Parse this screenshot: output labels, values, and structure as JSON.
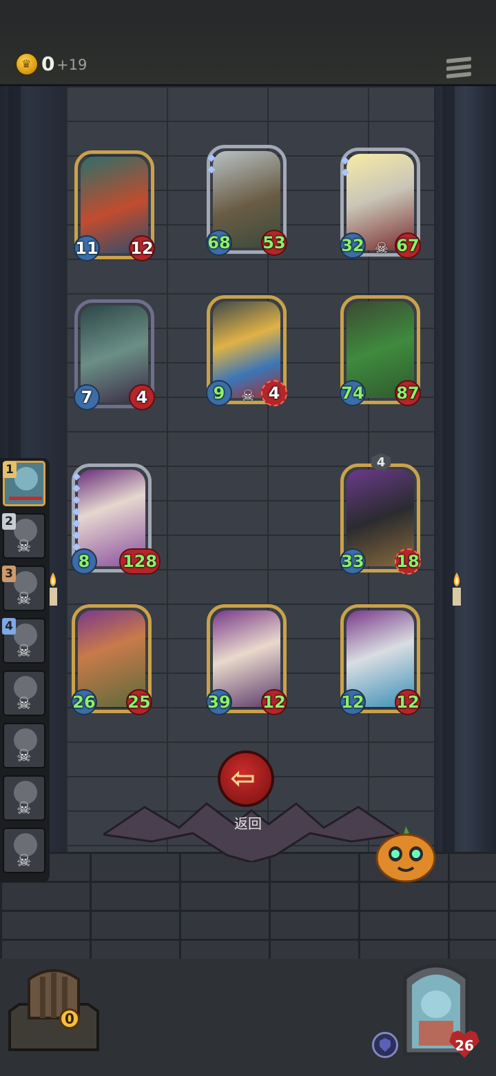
{
  "header": {
    "gold": "0",
    "gold_income": "+19"
  },
  "board": [
    {
      "id": "c1",
      "atk": "11",
      "hp": "12",
      "frame": "gold"
    },
    {
      "id": "c2",
      "atk": "68",
      "hp": "53",
      "frame": "silver",
      "atk_buff": true,
      "hp_buff": true,
      "gems": 2
    },
    {
      "id": "c3",
      "atk": "32",
      "hp": "67",
      "frame": "silver",
      "atk_buff": true,
      "hp_buff": true,
      "skull": true,
      "gems": 2
    },
    {
      "id": "c4",
      "atk": "7",
      "hp": "4",
      "frame": "dark"
    },
    {
      "id": "c5",
      "atk": "9",
      "hp": "4",
      "frame": "gold",
      "atk_buff": true,
      "skull": true,
      "hp_target": true
    },
    {
      "id": "c6",
      "atk": "74",
      "hp": "87",
      "frame": "gold",
      "atk_buff": true,
      "hp_buff": true
    },
    {
      "id": "c7",
      "atk": "8",
      "hp": "128",
      "frame": "silver",
      "atk_buff": true,
      "hp_buff": true,
      "gems": 7
    },
    {
      "id": "c8",
      "atk": "33",
      "hp": "18",
      "frame": "gold",
      "atk_buff": true,
      "hp_buff": true,
      "hp_target": true,
      "shield": "4"
    },
    {
      "id": "c9",
      "atk": "26",
      "hp": "25",
      "frame": "gold",
      "atk_buff": true,
      "hp_buff": true
    },
    {
      "id": "c10",
      "atk": "39",
      "hp": "12",
      "frame": "gold",
      "atk_buff": true,
      "hp_buff": true
    },
    {
      "id": "c11",
      "atk": "12",
      "hp": "12",
      "frame": "gold",
      "atk_buff": true,
      "hp_buff": true
    }
  ],
  "opponents": [
    {
      "rank": "1",
      "active": true
    },
    {
      "rank": "2",
      "dead": true
    },
    {
      "rank": "3",
      "dead": true
    },
    {
      "rank": "4",
      "dead": true
    },
    {
      "rank": "",
      "dead": true
    },
    {
      "rank": "",
      "dead": true
    },
    {
      "rank": "",
      "dead": true
    },
    {
      "rank": "",
      "dead": true
    }
  ],
  "back_button": {
    "label": "返回"
  },
  "chest": {
    "count": "0"
  },
  "hero": {
    "hp": "26"
  },
  "colors": {
    "gold_frame": "#caa24a",
    "silver_frame": "#a4a9b6",
    "attack": "#3b6ea8",
    "health": "#b3262a",
    "buff_text": "#8bf06a"
  }
}
